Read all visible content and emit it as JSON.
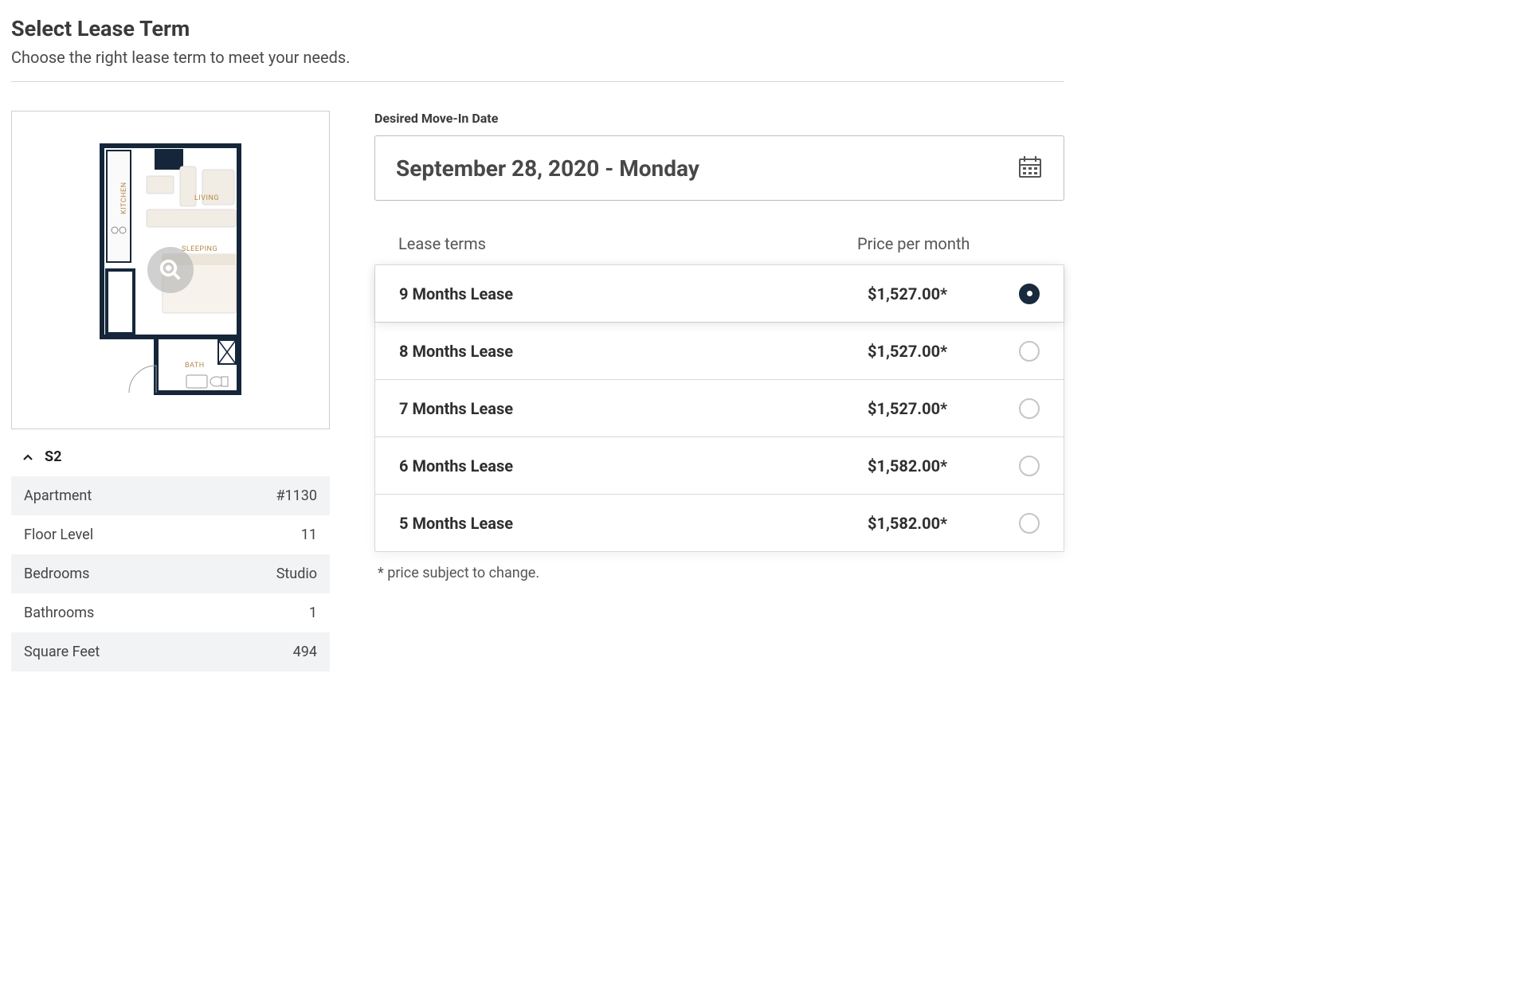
{
  "header": {
    "title": "Select Lease Term",
    "subtitle": "Choose the right lease term to meet your needs."
  },
  "unit": {
    "code": "S2",
    "details": [
      {
        "label": "Apartment",
        "value": "#1130"
      },
      {
        "label": "Floor Level",
        "value": "11"
      },
      {
        "label": "Bedrooms",
        "value": "Studio"
      },
      {
        "label": "Bathrooms",
        "value": "1"
      },
      {
        "label": "Square Feet",
        "value": "494"
      }
    ],
    "floorplan_labels": {
      "kitchen": "KITCHEN",
      "living": "LIVING",
      "sleeping": "SLEEPING",
      "bath": "BATH"
    }
  },
  "move_in": {
    "label": "Desired Move-In Date",
    "value": "September 28, 2020 - Monday"
  },
  "lease": {
    "headers": {
      "term": "Lease terms",
      "price": "Price per month"
    },
    "selected_index": 0,
    "options": [
      {
        "term": "9 Months Lease",
        "price": "$1,527.00*"
      },
      {
        "term": "8 Months Lease",
        "price": "$1,527.00*"
      },
      {
        "term": "7 Months Lease",
        "price": "$1,527.00*"
      },
      {
        "term": "6 Months Lease",
        "price": "$1,582.00*"
      },
      {
        "term": "5 Months Lease",
        "price": "$1,582.00*"
      }
    ],
    "footnote": "* price subject to change."
  }
}
